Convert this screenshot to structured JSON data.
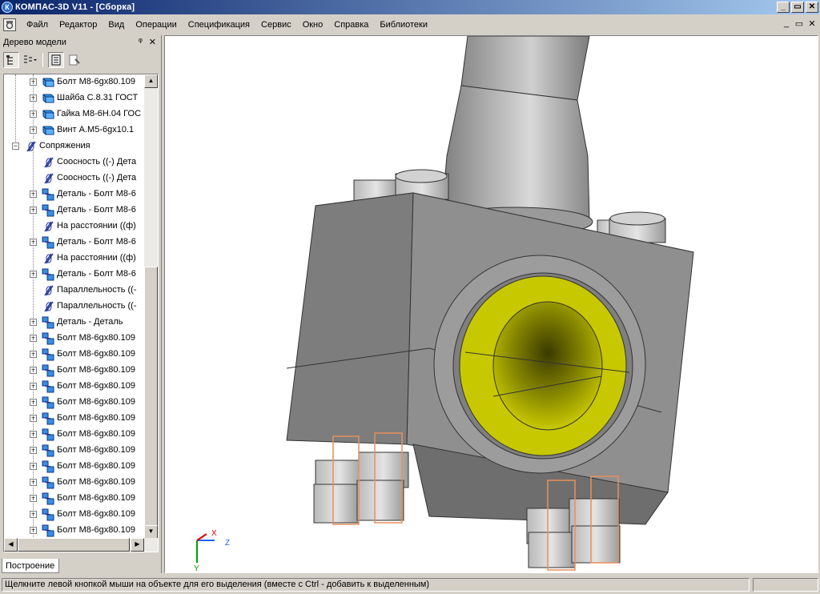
{
  "window": {
    "title": "КОМПАС-3D V11 - [Сборка]",
    "icon_letter": "К",
    "btn_min": "_",
    "btn_restore": "▭",
    "btn_close": "✕"
  },
  "menu": {
    "items": [
      "Файл",
      "Редактор",
      "Вид",
      "Операции",
      "Спецификация",
      "Сервис",
      "Окно",
      "Справка",
      "Библиотеки"
    ],
    "mdi_min": "_",
    "mdi_restore": "▭",
    "mdi_close": "✕"
  },
  "tree_panel": {
    "title": "Дерево модели",
    "pin": "ᵠ",
    "close": "✕",
    "tab_label": "Построение",
    "rows": [
      {
        "label": "Болт М8-6gx80.109",
        "icon": "component-icon",
        "level": 2,
        "expand": "+"
      },
      {
        "label": "Шайба С.8.31 ГОСТ",
        "icon": "component-icon",
        "level": 2,
        "expand": "+"
      },
      {
        "label": "Гайка  М8-6Н.04 ГОС",
        "icon": "component-icon",
        "level": 2,
        "expand": "+"
      },
      {
        "label": "Винт А.М5-6gx10.1",
        "icon": "component-icon",
        "level": 2,
        "expand": "+"
      },
      {
        "label": "Сопряжения",
        "icon": "mate-icon",
        "level": 1,
        "expand": "−"
      },
      {
        "label": "Соосность ((-) Дета",
        "icon": "mate-icon",
        "level": 2,
        "expand": ""
      },
      {
        "label": "Соосность ((-) Дета",
        "icon": "mate-icon",
        "level": 2,
        "expand": ""
      },
      {
        "label": "Деталь - Болт М8-6",
        "icon": "mate-group-icon",
        "level": 2,
        "expand": "+"
      },
      {
        "label": "Деталь - Болт М8-6",
        "icon": "mate-group-icon",
        "level": 2,
        "expand": "+"
      },
      {
        "label": "На расстоянии ((ф)",
        "icon": "mate-icon",
        "level": 2,
        "expand": ""
      },
      {
        "label": "Деталь - Болт М8-6",
        "icon": "mate-group-icon",
        "level": 2,
        "expand": "+"
      },
      {
        "label": "На расстоянии ((ф)",
        "icon": "mate-icon",
        "level": 2,
        "expand": ""
      },
      {
        "label": "Деталь - Болт М8-6",
        "icon": "mate-group-icon",
        "level": 2,
        "expand": "+"
      },
      {
        "label": "Параллельность ((-",
        "icon": "mate-icon",
        "level": 2,
        "expand": ""
      },
      {
        "label": "Параллельность ((-",
        "icon": "mate-icon",
        "level": 2,
        "expand": ""
      },
      {
        "label": "Деталь - Деталь",
        "icon": "mate-group-icon",
        "level": 2,
        "expand": "+"
      },
      {
        "label": "Болт М8-6gx80.109",
        "icon": "mate-group-icon",
        "level": 2,
        "expand": "+"
      },
      {
        "label": "Болт М8-6gx80.109",
        "icon": "mate-group-icon",
        "level": 2,
        "expand": "+"
      },
      {
        "label": "Болт М8-6gx80.109",
        "icon": "mate-group-icon",
        "level": 2,
        "expand": "+"
      },
      {
        "label": "Болт М8-6gx80.109",
        "icon": "mate-group-icon",
        "level": 2,
        "expand": "+"
      },
      {
        "label": "Болт М8-6gx80.109",
        "icon": "mate-group-icon",
        "level": 2,
        "expand": "+"
      },
      {
        "label": "Болт М8-6gx80.109",
        "icon": "mate-group-icon",
        "level": 2,
        "expand": "+"
      },
      {
        "label": "Болт М8-6gx80.109",
        "icon": "mate-group-icon",
        "level": 2,
        "expand": "+"
      },
      {
        "label": "Болт М8-6gx80.109",
        "icon": "mate-group-icon",
        "level": 2,
        "expand": "+"
      },
      {
        "label": "Болт М8-6gx80.109",
        "icon": "mate-group-icon",
        "level": 2,
        "expand": "+"
      },
      {
        "label": "Болт М8-6gx80.109",
        "icon": "mate-group-icon",
        "level": 2,
        "expand": "+"
      },
      {
        "label": "Болт М8-6gx80.109",
        "icon": "mate-group-icon",
        "level": 2,
        "expand": "+"
      },
      {
        "label": "Болт М8-6gx80.109",
        "icon": "mate-group-icon",
        "level": 2,
        "expand": "+"
      },
      {
        "label": "Болт М8-6gx80.109",
        "icon": "mate-group-icon",
        "level": 2,
        "expand": "+"
      }
    ]
  },
  "viewport": {
    "axis_x": "X",
    "axis_y": "Y",
    "axis_z": "Z",
    "colors": {
      "body": "#8c8c8c",
      "bushing": "#c8c800",
      "highlight": "#e8905a"
    }
  },
  "status": {
    "message": "Щелкните левой кнопкой мыши на объекте для его выделения (вместе с Ctrl - добавить к выделенным)"
  }
}
